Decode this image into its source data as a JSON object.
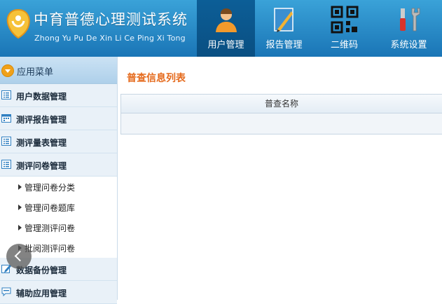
{
  "header": {
    "title": "中育普德心理测试系统",
    "subtitle": "Zhong Yu Pu De Xin Li Ce Ping Xi Tong",
    "nav": [
      {
        "label": "用户管理",
        "icon": "user-icon",
        "active": true
      },
      {
        "label": "报告管理",
        "icon": "report-icon",
        "active": false
      },
      {
        "label": "二维码",
        "icon": "qrcode-icon",
        "active": false
      },
      {
        "label": "系统设置",
        "icon": "tools-icon",
        "active": false
      }
    ]
  },
  "sidebar": {
    "menu_title": "应用菜单",
    "groups": [
      {
        "label": "用户数据管理",
        "icon": "list-icon"
      },
      {
        "label": "测评报告管理",
        "icon": "calendar-icon"
      },
      {
        "label": "测评量表管理",
        "icon": "list-icon"
      },
      {
        "label": "测评问卷管理",
        "icon": "list-icon"
      }
    ],
    "subitems": [
      "管理问卷分类",
      "管理问卷题库",
      "管理测评问卷",
      "批阅测评问卷"
    ],
    "groups_after": [
      {
        "label": "数据备份管理",
        "icon": "edit-icon"
      },
      {
        "label": "辅助应用管理",
        "icon": "chat-icon"
      }
    ]
  },
  "main": {
    "title": "普查信息列表",
    "table": {
      "columns": [
        "普查名称"
      ],
      "rows": [
        [
          ""
        ]
      ]
    }
  },
  "colors": {
    "header_blue": "#1a75b6",
    "active_nav": "#0a4f82",
    "title_orange": "#e56a1c"
  }
}
